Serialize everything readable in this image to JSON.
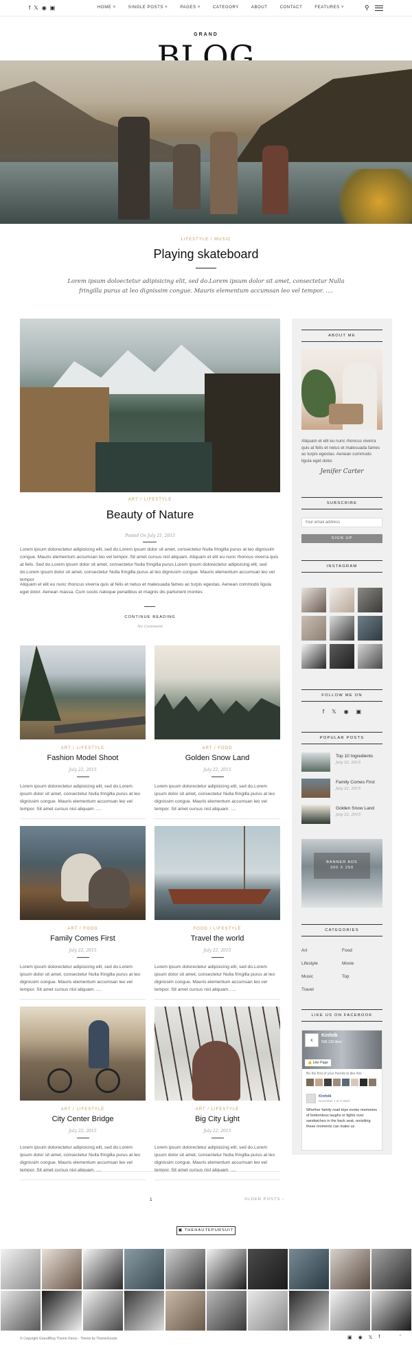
{
  "nav": {
    "items": [
      "HOME",
      "SINGLE POSTS",
      "PAGES",
      "CATEGORY",
      "ABOUT",
      "CONTACT",
      "FEATURES"
    ],
    "dropdowns": [
      true,
      true,
      true,
      false,
      false,
      false,
      true
    ],
    "social_icons": [
      "facebook-icon",
      "twitter-icon",
      "pinterest-icon",
      "instagram-icon"
    ]
  },
  "logo": {
    "small": "GRAND",
    "big": "BLOG"
  },
  "hero_post": {
    "tags": "LIFESTYLE / MUSIC",
    "title": "Playing skateboard",
    "excerpt": "Lorem ipsum doloectetur adipisicing elit, sed do.Lorem ipsum dolor sit amet, consectetur Nulla fringilla purus at leo dignissim congue. Mauris elementum accumsan leo vel tempor. ...."
  },
  "featured_post": {
    "tags": "ART / LIFESTYLE",
    "title": "Beauty of Nature",
    "date": "Posted On July 21, 2015",
    "para1": "Lorem ipsum dolorectetur adipisicing elit, sed do.Lorem ipsum dolor sit amet, consectetur Nulla fringilla purus at leo dignissim congue. Mauris elementum accumsan leo vel tempor. Sit amet cursus nisl aliquam. Aliquam et elit eu nunc rhoncus viverra quis at felis. Sed do.Lorem ipsum dolor sit amet, consectetur Nulla fringilla purus.Lorem ipsum dolorectetur adipisicing elit, sed do.Lorem ipsum dolor sit amet, consectetur Nulla fringilla purus at leo dignissim congue. Mauris elementum accumsan leo vel tempor",
    "para2": "Aliquam et elit eu nunc rhoncus viverra quis at felis et netus et malesuada fames ac turpis egestas. Aenean commodo ligula eget dolor. Aenean massa. Cum sociis natoque penatibus et magnis dis parturient montes",
    "continue": "CONTINUE READING",
    "comments": "No Comment"
  },
  "cards": [
    {
      "tags": "ART / LIFESTYLE",
      "title": "Fashion Model Shoot",
      "date": "July 22, 2015"
    },
    {
      "tags": "ART / FOOD",
      "title": "Golden Snow Land",
      "date": "July 22, 2015"
    },
    {
      "tags": "ART / FOOD",
      "title": "Family Comes First",
      "date": "July 22, 2015"
    },
    {
      "tags": "FOOD / LIFESTYLE",
      "title": "Travel the world",
      "date": "July 22, 2015"
    },
    {
      "tags": "ART / LIFESTYLE",
      "title": "City Center Bridge",
      "date": "July 22, 2015"
    },
    {
      "tags": "ART / LIFESTYLE",
      "title": "Big City Light",
      "date": "July 22, 2015"
    }
  ],
  "card_excerpt": "Lorem ipsum dolorectetur adipisicing elit, sed do.Lorem ipsum dolor sit amet, consectetur Nulla fringilla purus at leo dignissim congue. Mauris elementum accumsan leo vel tempor. Sit amet cursus nisl aliquam. ....",
  "pagination": {
    "page": "1",
    "older": "OLDER POSTS"
  },
  "sidebar": {
    "about_title": "ABOUT ME",
    "about_text": "Aliquam et elit eu nunc rhoncus viverra quis at felis et netus et malesuada fames ac turpis egestas. Aenean commodo ligula eget dolor.",
    "signature": "Jenifer Carter",
    "subscribe_title": "SUBSCRIBE",
    "email_placeholder": "Your email address",
    "signup": "SIGN UP",
    "instagram_title": "INSTAGRAM",
    "follow_title": "FOLLOW ME ON",
    "popular_title": "POPULAR POSTS",
    "popular": [
      {
        "title": "Top 10 Ingredients",
        "date": "July 22, 2015"
      },
      {
        "title": "Family Comes First",
        "date": "July 22, 2015"
      },
      {
        "title": "Golden Snow Land",
        "date": "July 22, 2015"
      }
    ],
    "banner": {
      "line1": "BANNER ADS",
      "line2": "300 X 250"
    },
    "categories_title": "CATEGORIES",
    "categories": [
      "Art",
      "Food",
      "Lifestyle",
      "Movie",
      "Music",
      "Top",
      "Travel"
    ],
    "facebook_title": "LIKE US ON FACEBOOK",
    "fb": {
      "page": "Kinfolk",
      "likes": "508,139 likes",
      "like_btn": "Like Page",
      "friends": "Be the first of your friends to like this",
      "post_name": "Kinfolk",
      "post_date": "November 1 at 3:15am",
      "post_text": "Whether family road trips evoke memories of bottomless laughs or fights over sandwiches in the back seat, revisiting these moments can make us"
    }
  },
  "footer": {
    "insta_handle": "THEHAUTEPURSUIT",
    "copyright": "© Copyright GrandBlog Theme Demo - Theme by ThemeGoods"
  }
}
